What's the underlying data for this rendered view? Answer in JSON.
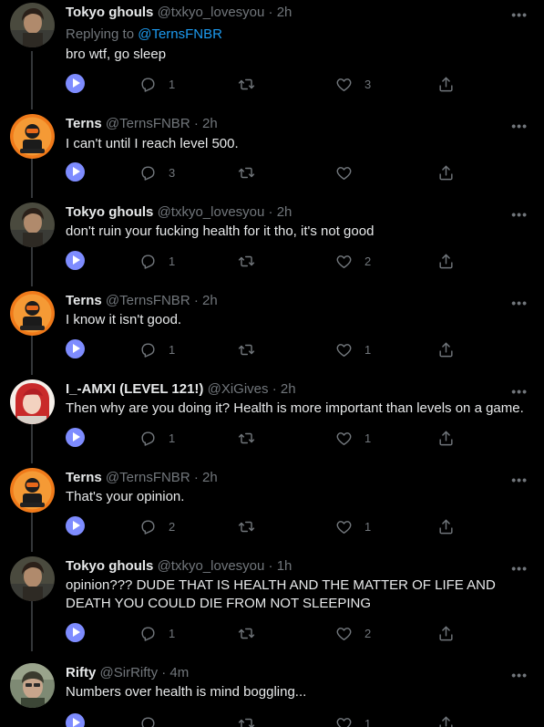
{
  "tweets": [
    {
      "name": "Tokyo ghouls",
      "handle": "@txkyo_lovesyou",
      "time": "2h",
      "replying_prefix": "Replying to",
      "replying_to": "@TernsFNBR",
      "lines": [
        "bro wtf, go sleep"
      ],
      "replies": "1",
      "retweets": "",
      "likes": "3",
      "avatar": "tokyo"
    },
    {
      "name": "Terns",
      "handle": "@TernsFNBR",
      "time": "2h",
      "lines": [
        "I can't until I reach level 500."
      ],
      "replies": "3",
      "retweets": "",
      "likes": "",
      "avatar": "terns"
    },
    {
      "name": "Tokyo ghouls",
      "handle": "@txkyo_lovesyou",
      "time": "2h",
      "lines": [
        "don't ruin your fucking health for it tho, it's not good"
      ],
      "replies": "1",
      "retweets": "",
      "likes": "2",
      "avatar": "tokyo"
    },
    {
      "name": "Terns",
      "handle": "@TernsFNBR",
      "time": "2h",
      "lines": [
        "I know it isn't good."
      ],
      "replies": "1",
      "retweets": "",
      "likes": "1",
      "avatar": "terns"
    },
    {
      "name": "I_-AMXI (LEVEL 121!)",
      "handle": "@XiGives",
      "time": "2h",
      "lines": [
        "Then why are you doing it? Health is more important than levels on a game."
      ],
      "replies": "1",
      "retweets": "",
      "likes": "1",
      "avatar": "amxi"
    },
    {
      "name": "Terns",
      "handle": "@TernsFNBR",
      "time": "2h",
      "lines": [
        "That's your opinion."
      ],
      "replies": "2",
      "retweets": "",
      "likes": "1",
      "avatar": "terns"
    },
    {
      "name": "Tokyo ghouls",
      "handle": "@txkyo_lovesyou",
      "time": "1h",
      "lines": [
        "opinion??? DUDE THAT IS HEALTH AND THE MATTER OF LIFE AND",
        "DEATH YOU COULD DIE FROM NOT SLEEPING"
      ],
      "replies": "1",
      "retweets": "",
      "likes": "2",
      "avatar": "tokyo"
    },
    {
      "name": "Rifty",
      "handle": "@SirRifty",
      "time": "4m",
      "lines": [
        "Numbers over health is mind boggling..."
      ],
      "replies": "",
      "retweets": "",
      "likes": "1",
      "avatar": "rifty"
    }
  ],
  "separator": "·",
  "more_glyph": "•••",
  "colors": {
    "background": "#000000",
    "text": "#e7e9ea",
    "muted": "#71767b",
    "link": "#1d9bf0",
    "play": "#7e8cff"
  }
}
